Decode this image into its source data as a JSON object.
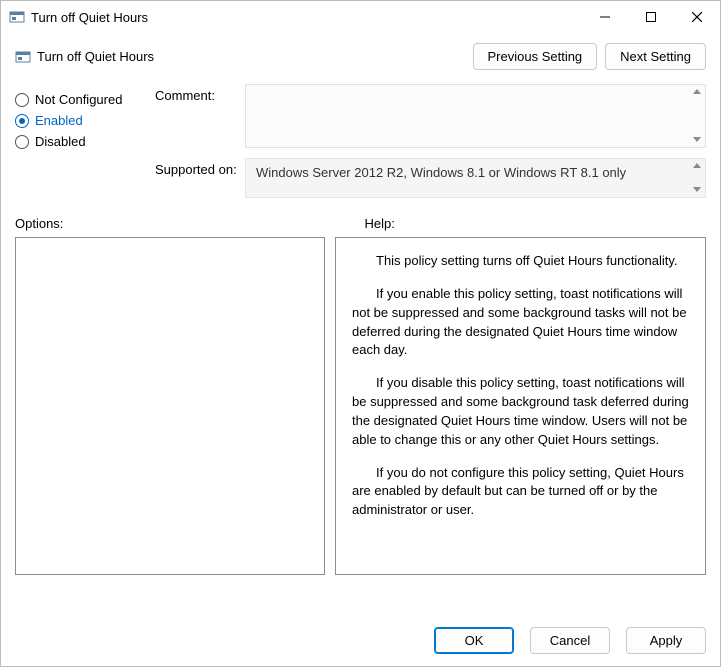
{
  "colors": {
    "accent": "#0067c0",
    "border": "#bdbdbd"
  },
  "title": "Turn off Quiet Hours",
  "header": {
    "title": "Turn off Quiet Hours",
    "prev_label": "Previous Setting",
    "next_label": "Next Setting"
  },
  "state": {
    "selected": "enabled",
    "not_configured_label": "Not Configured",
    "enabled_label": "Enabled",
    "disabled_label": "Disabled"
  },
  "fields": {
    "comment_label": "Comment:",
    "comment_value": "",
    "supported_label": "Supported on:",
    "supported_value": "Windows Server 2012 R2, Windows 8.1 or Windows RT 8.1 only"
  },
  "sections": {
    "options_label": "Options:",
    "help_label": "Help:"
  },
  "options_content": "",
  "help": {
    "p1": "This policy setting turns off Quiet Hours functionality.",
    "p2": "If you enable this policy setting, toast notifications will not be suppressed and some background tasks will not be deferred during the designated Quiet Hours time window each day.",
    "p3": "If you disable this policy setting, toast notifications will be suppressed and some background task deferred during the designated Quiet Hours time window.  Users will not be able to change this or any other Quiet Hours settings.",
    "p4": "If you do not configure this policy setting, Quiet Hours are enabled by default but can be turned off or by the administrator or user."
  },
  "footer": {
    "ok_label": "OK",
    "cancel_label": "Cancel",
    "apply_label": "Apply"
  }
}
